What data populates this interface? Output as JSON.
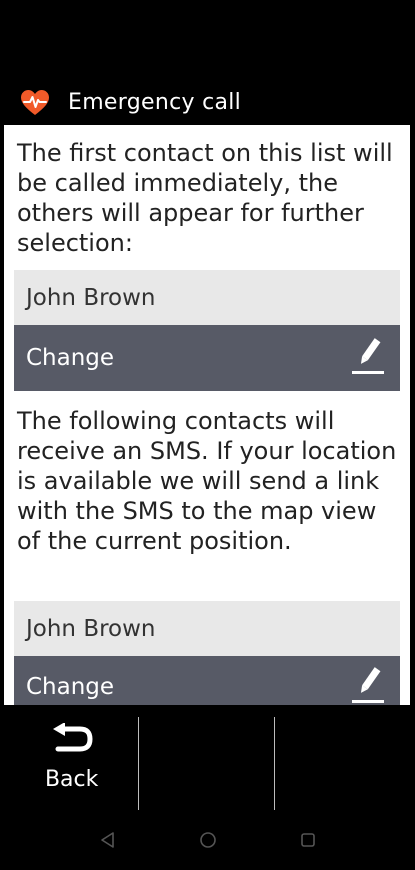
{
  "header": {
    "title": "Emergency call",
    "icon": "heart-pulse-icon",
    "icon_color": "#f15a29"
  },
  "main": {
    "first_instruction": "The first contact on this list will be called immediately, the others will appear for further selection:",
    "first_contact": {
      "name": "John Brown",
      "change_label": "Change"
    },
    "second_instruction": "The following contacts will receive an SMS. If your location is available we will send a link with the SMS to the map view of the current position.",
    "second_contact": {
      "name": "John Brown",
      "change_label": "Change"
    }
  },
  "bottom_bar": {
    "back_label": "Back",
    "back_icon": "back-arrow-icon"
  },
  "nav_bar": {
    "buttons": [
      "back-triangle-icon",
      "home-circle-icon",
      "recents-square-icon"
    ]
  },
  "colors": {
    "accent": "#f15a29",
    "button_bg": "#575a66",
    "contact_bg": "#e8e8e8"
  }
}
